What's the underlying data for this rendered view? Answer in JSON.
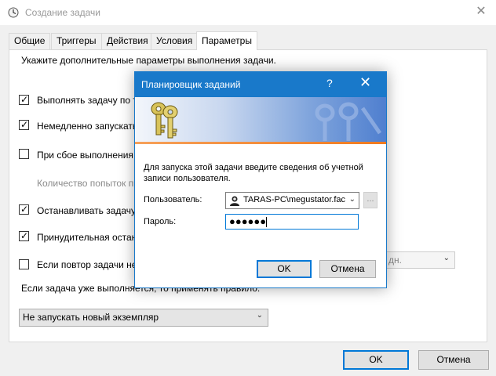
{
  "main_window": {
    "title": "Создание задачи",
    "close_glyph": "✕"
  },
  "tabs": [
    {
      "label": "Общие",
      "active": false
    },
    {
      "label": "Триггеры",
      "active": false
    },
    {
      "label": "Действия",
      "active": false
    },
    {
      "label": "Условия",
      "active": false
    },
    {
      "label": "Параметры",
      "active": true
    }
  ],
  "settings": {
    "intro": "Укажите дополнительные параметры выполнения задачи.",
    "options": [
      {
        "label": "Выполнять задачу по т",
        "checked": true,
        "disabled": false
      },
      {
        "label": "Немедленно запускать",
        "checked": true,
        "disabled": false
      },
      {
        "label": "При сбое выполнения",
        "checked": false,
        "disabled": false
      },
      {
        "label": "Количество попыток п",
        "checked": null,
        "disabled": true
      },
      {
        "label": "Останавливать задачу,",
        "checked": true,
        "disabled": false
      },
      {
        "label": "Принудительная остан",
        "checked": true,
        "disabled": false
      },
      {
        "label": "Если повтор задачи не",
        "checked": false,
        "disabled": false
      }
    ],
    "restart_combo_value": "дн.",
    "rule_text": "Если задача уже выполняется, то применять правило:",
    "rule_combo_value": "Не запускать новый экземпляр"
  },
  "main_buttons": {
    "ok": "OK",
    "cancel": "Отмена"
  },
  "dialog": {
    "title": "Планировщик заданий",
    "help_glyph": "?",
    "close_glyph": "✕",
    "instruction": "Для запуска этой задачи введите сведения об учетной записи пользователя.",
    "user_label": "Пользователь:",
    "user_value": "TARAS-PC\\megustator.fac",
    "browse_label": "...",
    "password_label": "Пароль:",
    "password_value": "●●●●●●",
    "ok": "OK",
    "cancel": "Отмена"
  },
  "colors": {
    "accent": "#0078d7",
    "dialog_title_bar": "#1979ca",
    "banner_stripe": "#f07a1e"
  },
  "icons": {
    "window_icon": "clock-icon",
    "banner_icon": "keys-icon",
    "user_icon": "user-icon"
  }
}
